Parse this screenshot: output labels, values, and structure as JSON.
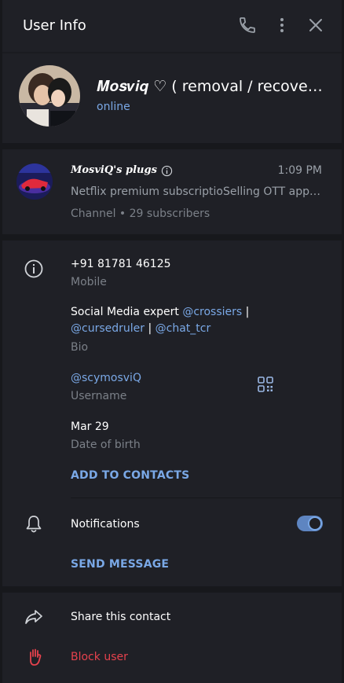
{
  "header": {
    "title": "User Info",
    "icons": [
      "phone-icon",
      "more-vertical-icon",
      "close-icon"
    ]
  },
  "profile": {
    "name": "𝑴𝒐𝒔𝒗𝒊𝒒 ♡ ( removal / recovery )",
    "status": "online"
  },
  "channel": {
    "name": "𝑴𝒐𝒔𝒗𝒊𝑸'𝒔 𝒑𝒍𝒖𝒈𝒔",
    "time": "1:09 PM",
    "message": "Netflix premium subscriptioSelling OTT apps at cheap rates",
    "subtitle": "Channel • 29 subscribers"
  },
  "info": {
    "phone": "+91 81781 46125",
    "phone_label": "Mobile",
    "bio_prefix": "Social Media expert ",
    "bio_mention1": "@crossiers",
    "bio_sep1": " |",
    "bio_mention2": "@cursedruler",
    "bio_sep2": " | ",
    "bio_mention3": "@chat_tcr",
    "bio_label": "Bio",
    "username": "@scymosviQ",
    "username_label": "Username",
    "birthday": "Mar 29",
    "birthday_label": "Date of birth",
    "add_contacts": "ADD TO CONTACTS"
  },
  "notifications": {
    "label": "Notifications",
    "enabled": true,
    "send_message": "SEND MESSAGE"
  },
  "actions": {
    "share": "Share this contact",
    "block": "Block user"
  },
  "colors": {
    "accent": "#7aa8e6",
    "danger": "#e5424d",
    "panel": "#1f2026",
    "separator": "#17181c"
  }
}
